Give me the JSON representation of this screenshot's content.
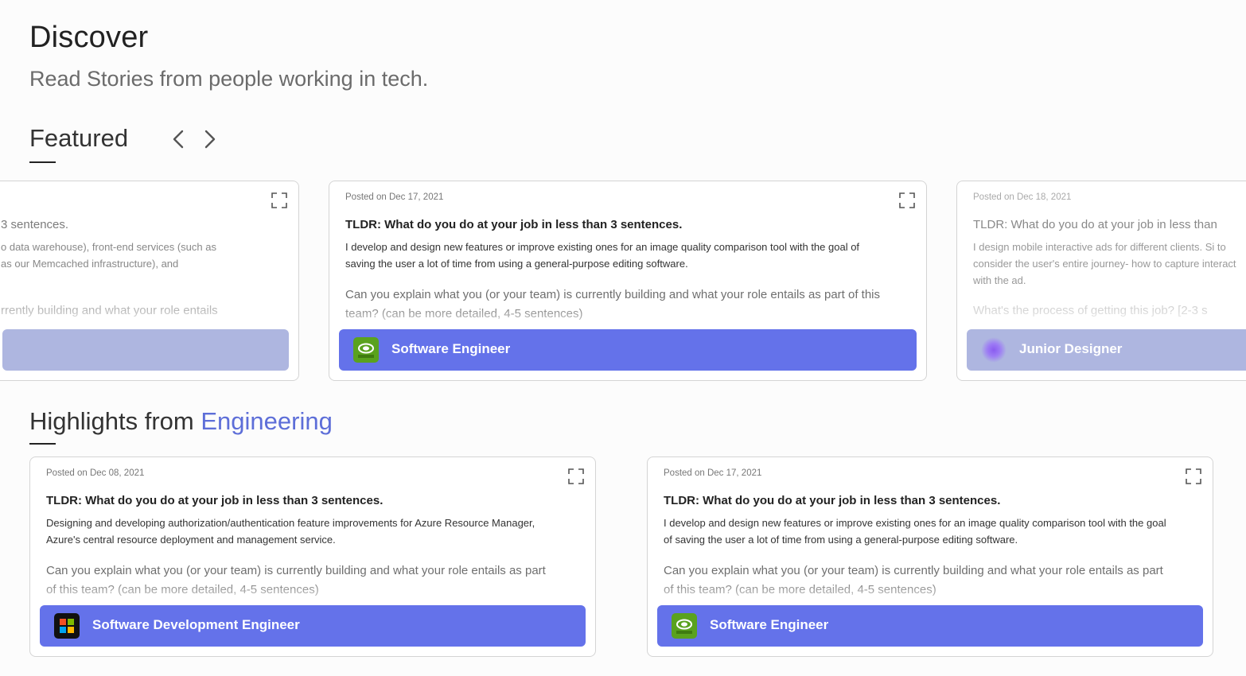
{
  "header": {
    "title": "Discover",
    "subtitle": "Read Stories from people working in tech."
  },
  "featured": {
    "heading": "Featured",
    "cards": [
      {
        "posted": "",
        "q1": "3 sentences.",
        "a1_line1": "o data warehouse), front-end services (such as",
        "a1_line2": "as our Memcached infrastructure), and",
        "q2": "rrently building and what your role entails",
        "role": ""
      },
      {
        "posted": "Posted on Dec 17, 2021",
        "q1": "TLDR: What do you do at your job in less than 3 sentences.",
        "a1": "I develop and design new features or improve existing ones for an image quality comparison tool with the goal of saving the user a lot of time from using a general-purpose editing software.",
        "q2": "Can you explain what you (or your team) is currently building and what your role entails as part of this team? (can be more detailed, 4-5 sentences)",
        "role": "Software Engineer"
      },
      {
        "posted": "Posted on Dec 18, 2021",
        "q1": "TLDR: What do you do at your job in less than",
        "a1": "I design mobile interactive ads for different clients. Si to consider the user's entire journey- how to capture interact with the ad.",
        "q2": "What's the process of getting this job? [2-3 s",
        "role": "Junior Designer"
      }
    ]
  },
  "highlights": {
    "heading_prefix": "Highlights from ",
    "heading_accent": "Engineering",
    "cards": [
      {
        "posted": "Posted on Dec 08, 2021",
        "q1": "TLDR: What do you do at your job in less than 3 sentences.",
        "a1": "Designing and developing authorization/authentication feature improvements for Azure Resource Manager, Azure's central resource deployment and management service.",
        "q2": "Can you explain what you (or your team) is currently building and what your role entails as part of this team? (can be more detailed, 4-5 sentences)",
        "role": "Software Development Engineer"
      },
      {
        "posted": "Posted on Dec 17, 2021",
        "q1": "TLDR: What do you do at your job in less than 3 sentences.",
        "a1": "I develop and design new features or improve existing ones for an image quality comparison tool with the goal of saving the user a lot of time from using a general-purpose editing software.",
        "q2": "Can you explain what you (or your team) is currently building and what your role entails as part of this team? (can be more detailed, 4-5 sentences)",
        "role": "Software Engineer"
      }
    ]
  },
  "icons": {
    "prev": "chevron-left-icon",
    "next": "chevron-right-icon",
    "expand": "expand-icon",
    "nvidia": "nvidia-logo",
    "microsoft": "microsoft-logo"
  },
  "colors": {
    "accent": "#5d6ed8",
    "role_bar": "#6472ea"
  }
}
